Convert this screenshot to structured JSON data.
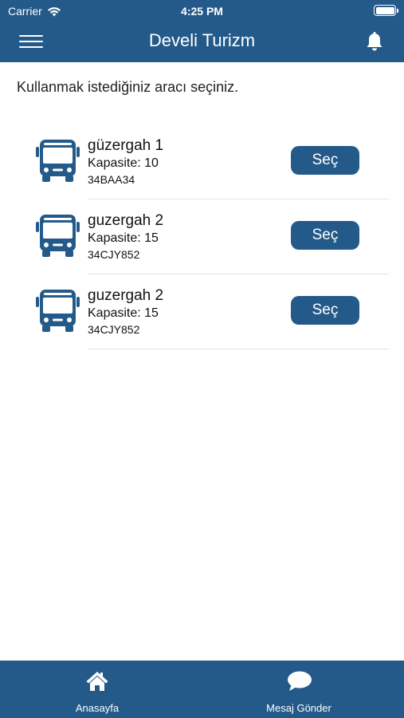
{
  "status_bar": {
    "carrier": "Carrier",
    "time": "4:25 PM",
    "icons": [
      "wifi-icon",
      "battery-icon"
    ]
  },
  "nav": {
    "title": "Develi Turizm",
    "left_icon": "hamburger-menu-icon",
    "right_icon": "bell-icon"
  },
  "instruction": "Kullanmak istediğiniz aracı seçiniz.",
  "vehicles": [
    {
      "name": "güzergah 1",
      "capacity": "Kapasite: 10",
      "plate": "34BAA34",
      "button": "Seç"
    },
    {
      "name": "guzergah 2",
      "capacity": "Kapasite: 15",
      "plate": "34CJY852",
      "button": "Seç"
    },
    {
      "name": "guzergah 2",
      "capacity": "Kapasite: 15",
      "plate": "34CJY852",
      "button": "Seç"
    }
  ],
  "tabs": [
    {
      "label": "Anasayfa",
      "icon": "home-icon"
    },
    {
      "label": "Mesaj Gönder",
      "icon": "chat-bubble-icon"
    }
  ],
  "colors": {
    "primary": "#245a8a",
    "background": "#ffffff",
    "text": "#222222",
    "divider": "#e2e2e2"
  }
}
